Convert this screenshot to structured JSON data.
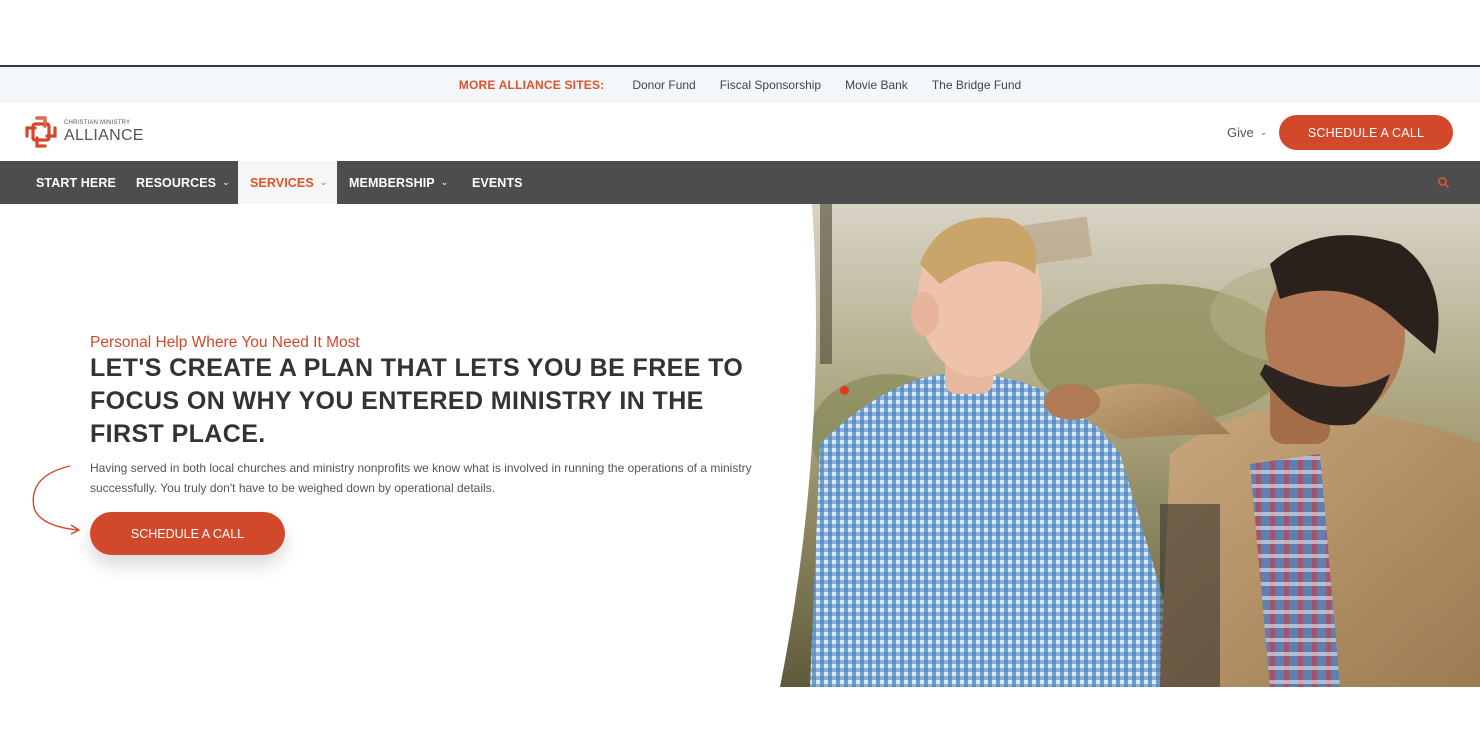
{
  "sites_bar": {
    "label": "MORE ALLIANCE SITES:",
    "links": [
      "Donor Fund",
      "Fiscal Sponsorship",
      "Movie Bank",
      "The Bridge Fund"
    ]
  },
  "header": {
    "logo_small": "CHRISTIAN MINISTRY",
    "logo_big": "ALLIANCE",
    "give_label": "Give",
    "cta_label": "SCHEDULE A CALL"
  },
  "nav": {
    "items": [
      {
        "label": "START HERE"
      },
      {
        "label": "RESOURCES"
      },
      {
        "label": "SERVICES"
      },
      {
        "label": "MEMBERSHIP"
      },
      {
        "label": "EVENTS"
      }
    ]
  },
  "hero": {
    "eyebrow": "Personal Help Where You Need It Most",
    "headline": "LET'S CREATE A PLAN THAT LETS YOU BE FREE TO FOCUS ON WHY YOU ENTERED MINISTRY IN THE FIRST PLACE.",
    "body": "Having served in both local churches and ministry nonprofits we know what is involved in running the operations of a ministry successfully. You truly don't have to be weighed down by operational details.",
    "cta_label": "SCHEDULE A CALL"
  },
  "colors": {
    "accent": "#d2482a",
    "nav_bg": "#4d4d4d",
    "sites_bg": "#f4f7fa"
  },
  "icons": {
    "search": "search-icon",
    "chevron": "chevron-down-icon",
    "logo": "cross-knot-logo-icon",
    "arrow": "curved-arrow-icon"
  }
}
